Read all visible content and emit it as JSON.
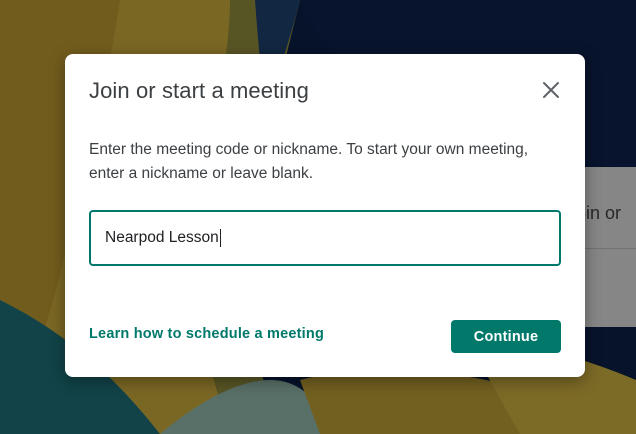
{
  "dialog": {
    "title": "Join or start a meeting",
    "description": "Enter the meeting code or nickname. To start your own meeting, enter a nickname or leave blank.",
    "input_value": "Nearpod Lesson",
    "learn_link": "Learn how to schedule a meeting",
    "continue_label": "Continue",
    "close_icon": "close-icon"
  },
  "background": {
    "partial_text": "oin or"
  },
  "colors": {
    "accent": "#00796b",
    "title": "#3c4043",
    "dialog_bg": "#ffffff",
    "backdrop": "#0b1a3c"
  }
}
